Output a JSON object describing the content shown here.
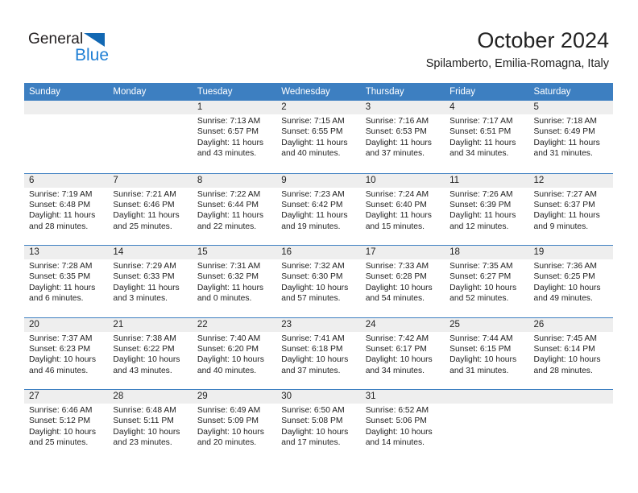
{
  "logo": {
    "word_top": "General",
    "word_bottom": "Blue",
    "triangle_color": "#1268b3",
    "blue_color": "#1f7fd4"
  },
  "header": {
    "title": "October 2024",
    "subtitle": "Spilamberto, Emilia-Romagna, Italy"
  },
  "theme": {
    "header_blue": "#3d7fc1",
    "dateband_gray": "#eeeeee",
    "text": "#222222"
  },
  "weekdays": [
    "Sunday",
    "Monday",
    "Tuesday",
    "Wednesday",
    "Thursday",
    "Friday",
    "Saturday"
  ],
  "weeks": [
    [
      {
        "day": "",
        "sunrise": "",
        "sunset": "",
        "daylight_line1": "",
        "daylight_line2": ""
      },
      {
        "day": "",
        "sunrise": "",
        "sunset": "",
        "daylight_line1": "",
        "daylight_line2": ""
      },
      {
        "day": "1",
        "sunrise": "Sunrise: 7:13 AM",
        "sunset": "Sunset: 6:57 PM",
        "daylight_line1": "Daylight: 11 hours",
        "daylight_line2": "and 43 minutes."
      },
      {
        "day": "2",
        "sunrise": "Sunrise: 7:15 AM",
        "sunset": "Sunset: 6:55 PM",
        "daylight_line1": "Daylight: 11 hours",
        "daylight_line2": "and 40 minutes."
      },
      {
        "day": "3",
        "sunrise": "Sunrise: 7:16 AM",
        "sunset": "Sunset: 6:53 PM",
        "daylight_line1": "Daylight: 11 hours",
        "daylight_line2": "and 37 minutes."
      },
      {
        "day": "4",
        "sunrise": "Sunrise: 7:17 AM",
        "sunset": "Sunset: 6:51 PM",
        "daylight_line1": "Daylight: 11 hours",
        "daylight_line2": "and 34 minutes."
      },
      {
        "day": "5",
        "sunrise": "Sunrise: 7:18 AM",
        "sunset": "Sunset: 6:49 PM",
        "daylight_line1": "Daylight: 11 hours",
        "daylight_line2": "and 31 minutes."
      }
    ],
    [
      {
        "day": "6",
        "sunrise": "Sunrise: 7:19 AM",
        "sunset": "Sunset: 6:48 PM",
        "daylight_line1": "Daylight: 11 hours",
        "daylight_line2": "and 28 minutes."
      },
      {
        "day": "7",
        "sunrise": "Sunrise: 7:21 AM",
        "sunset": "Sunset: 6:46 PM",
        "daylight_line1": "Daylight: 11 hours",
        "daylight_line2": "and 25 minutes."
      },
      {
        "day": "8",
        "sunrise": "Sunrise: 7:22 AM",
        "sunset": "Sunset: 6:44 PM",
        "daylight_line1": "Daylight: 11 hours",
        "daylight_line2": "and 22 minutes."
      },
      {
        "day": "9",
        "sunrise": "Sunrise: 7:23 AM",
        "sunset": "Sunset: 6:42 PM",
        "daylight_line1": "Daylight: 11 hours",
        "daylight_line2": "and 19 minutes."
      },
      {
        "day": "10",
        "sunrise": "Sunrise: 7:24 AM",
        "sunset": "Sunset: 6:40 PM",
        "daylight_line1": "Daylight: 11 hours",
        "daylight_line2": "and 15 minutes."
      },
      {
        "day": "11",
        "sunrise": "Sunrise: 7:26 AM",
        "sunset": "Sunset: 6:39 PM",
        "daylight_line1": "Daylight: 11 hours",
        "daylight_line2": "and 12 minutes."
      },
      {
        "day": "12",
        "sunrise": "Sunrise: 7:27 AM",
        "sunset": "Sunset: 6:37 PM",
        "daylight_line1": "Daylight: 11 hours",
        "daylight_line2": "and 9 minutes."
      }
    ],
    [
      {
        "day": "13",
        "sunrise": "Sunrise: 7:28 AM",
        "sunset": "Sunset: 6:35 PM",
        "daylight_line1": "Daylight: 11 hours",
        "daylight_line2": "and 6 minutes."
      },
      {
        "day": "14",
        "sunrise": "Sunrise: 7:29 AM",
        "sunset": "Sunset: 6:33 PM",
        "daylight_line1": "Daylight: 11 hours",
        "daylight_line2": "and 3 minutes."
      },
      {
        "day": "15",
        "sunrise": "Sunrise: 7:31 AM",
        "sunset": "Sunset: 6:32 PM",
        "daylight_line1": "Daylight: 11 hours",
        "daylight_line2": "and 0 minutes."
      },
      {
        "day": "16",
        "sunrise": "Sunrise: 7:32 AM",
        "sunset": "Sunset: 6:30 PM",
        "daylight_line1": "Daylight: 10 hours",
        "daylight_line2": "and 57 minutes."
      },
      {
        "day": "17",
        "sunrise": "Sunrise: 7:33 AM",
        "sunset": "Sunset: 6:28 PM",
        "daylight_line1": "Daylight: 10 hours",
        "daylight_line2": "and 54 minutes."
      },
      {
        "day": "18",
        "sunrise": "Sunrise: 7:35 AM",
        "sunset": "Sunset: 6:27 PM",
        "daylight_line1": "Daylight: 10 hours",
        "daylight_line2": "and 52 minutes."
      },
      {
        "day": "19",
        "sunrise": "Sunrise: 7:36 AM",
        "sunset": "Sunset: 6:25 PM",
        "daylight_line1": "Daylight: 10 hours",
        "daylight_line2": "and 49 minutes."
      }
    ],
    [
      {
        "day": "20",
        "sunrise": "Sunrise: 7:37 AM",
        "sunset": "Sunset: 6:23 PM",
        "daylight_line1": "Daylight: 10 hours",
        "daylight_line2": "and 46 minutes."
      },
      {
        "day": "21",
        "sunrise": "Sunrise: 7:38 AM",
        "sunset": "Sunset: 6:22 PM",
        "daylight_line1": "Daylight: 10 hours",
        "daylight_line2": "and 43 minutes."
      },
      {
        "day": "22",
        "sunrise": "Sunrise: 7:40 AM",
        "sunset": "Sunset: 6:20 PM",
        "daylight_line1": "Daylight: 10 hours",
        "daylight_line2": "and 40 minutes."
      },
      {
        "day": "23",
        "sunrise": "Sunrise: 7:41 AM",
        "sunset": "Sunset: 6:18 PM",
        "daylight_line1": "Daylight: 10 hours",
        "daylight_line2": "and 37 minutes."
      },
      {
        "day": "24",
        "sunrise": "Sunrise: 7:42 AM",
        "sunset": "Sunset: 6:17 PM",
        "daylight_line1": "Daylight: 10 hours",
        "daylight_line2": "and 34 minutes."
      },
      {
        "day": "25",
        "sunrise": "Sunrise: 7:44 AM",
        "sunset": "Sunset: 6:15 PM",
        "daylight_line1": "Daylight: 10 hours",
        "daylight_line2": "and 31 minutes."
      },
      {
        "day": "26",
        "sunrise": "Sunrise: 7:45 AM",
        "sunset": "Sunset: 6:14 PM",
        "daylight_line1": "Daylight: 10 hours",
        "daylight_line2": "and 28 minutes."
      }
    ],
    [
      {
        "day": "27",
        "sunrise": "Sunrise: 6:46 AM",
        "sunset": "Sunset: 5:12 PM",
        "daylight_line1": "Daylight: 10 hours",
        "daylight_line2": "and 25 minutes."
      },
      {
        "day": "28",
        "sunrise": "Sunrise: 6:48 AM",
        "sunset": "Sunset: 5:11 PM",
        "daylight_line1": "Daylight: 10 hours",
        "daylight_line2": "and 23 minutes."
      },
      {
        "day": "29",
        "sunrise": "Sunrise: 6:49 AM",
        "sunset": "Sunset: 5:09 PM",
        "daylight_line1": "Daylight: 10 hours",
        "daylight_line2": "and 20 minutes."
      },
      {
        "day": "30",
        "sunrise": "Sunrise: 6:50 AM",
        "sunset": "Sunset: 5:08 PM",
        "daylight_line1": "Daylight: 10 hours",
        "daylight_line2": "and 17 minutes."
      },
      {
        "day": "31",
        "sunrise": "Sunrise: 6:52 AM",
        "sunset": "Sunset: 5:06 PM",
        "daylight_line1": "Daylight: 10 hours",
        "daylight_line2": "and 14 minutes."
      },
      {
        "day": "",
        "sunrise": "",
        "sunset": "",
        "daylight_line1": "",
        "daylight_line2": ""
      },
      {
        "day": "",
        "sunrise": "",
        "sunset": "",
        "daylight_line1": "",
        "daylight_line2": ""
      }
    ]
  ]
}
